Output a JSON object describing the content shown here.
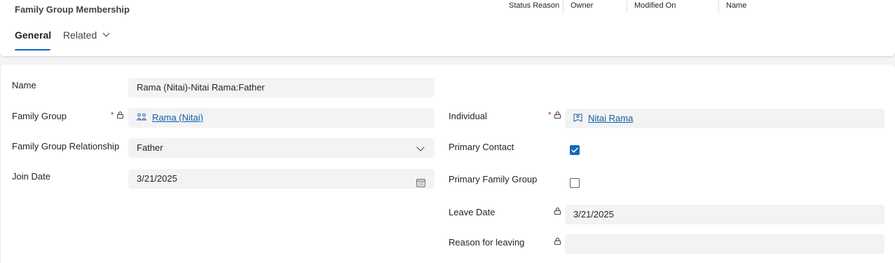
{
  "header": {
    "entity_title": "Family Group Membership",
    "fields": [
      "Status Reason",
      "Owner",
      "Modified On",
      "Name"
    ]
  },
  "tabs": [
    {
      "label": "General",
      "selected": true
    },
    {
      "label": "Related",
      "selected": false
    }
  ],
  "form": {
    "name": {
      "label": "Name",
      "value": "Rama (Nitai)-Nitai Rama:Father"
    },
    "family_group": {
      "label": "Family Group",
      "required": "*",
      "value": "Rama (Nitai)"
    },
    "relationship": {
      "label": "Family Group Relationship",
      "value": "Father"
    },
    "join_date": {
      "label": "Join Date",
      "value": "3/21/2025"
    },
    "individual": {
      "label": "Individual",
      "required": "*",
      "value": "Nitai Rama"
    },
    "primary_contact": {
      "label": "Primary Contact",
      "checked": true
    },
    "primary_family_group": {
      "label": "Primary Family Group",
      "checked": false
    },
    "leave_date": {
      "label": "Leave Date",
      "value": "3/21/2025"
    },
    "reason_for_leaving": {
      "label": "Reason for leaving",
      "value": ""
    }
  },
  "colors": {
    "accent": "#0f6cbd",
    "link": "#115ea3",
    "required": "#c50f1f"
  }
}
